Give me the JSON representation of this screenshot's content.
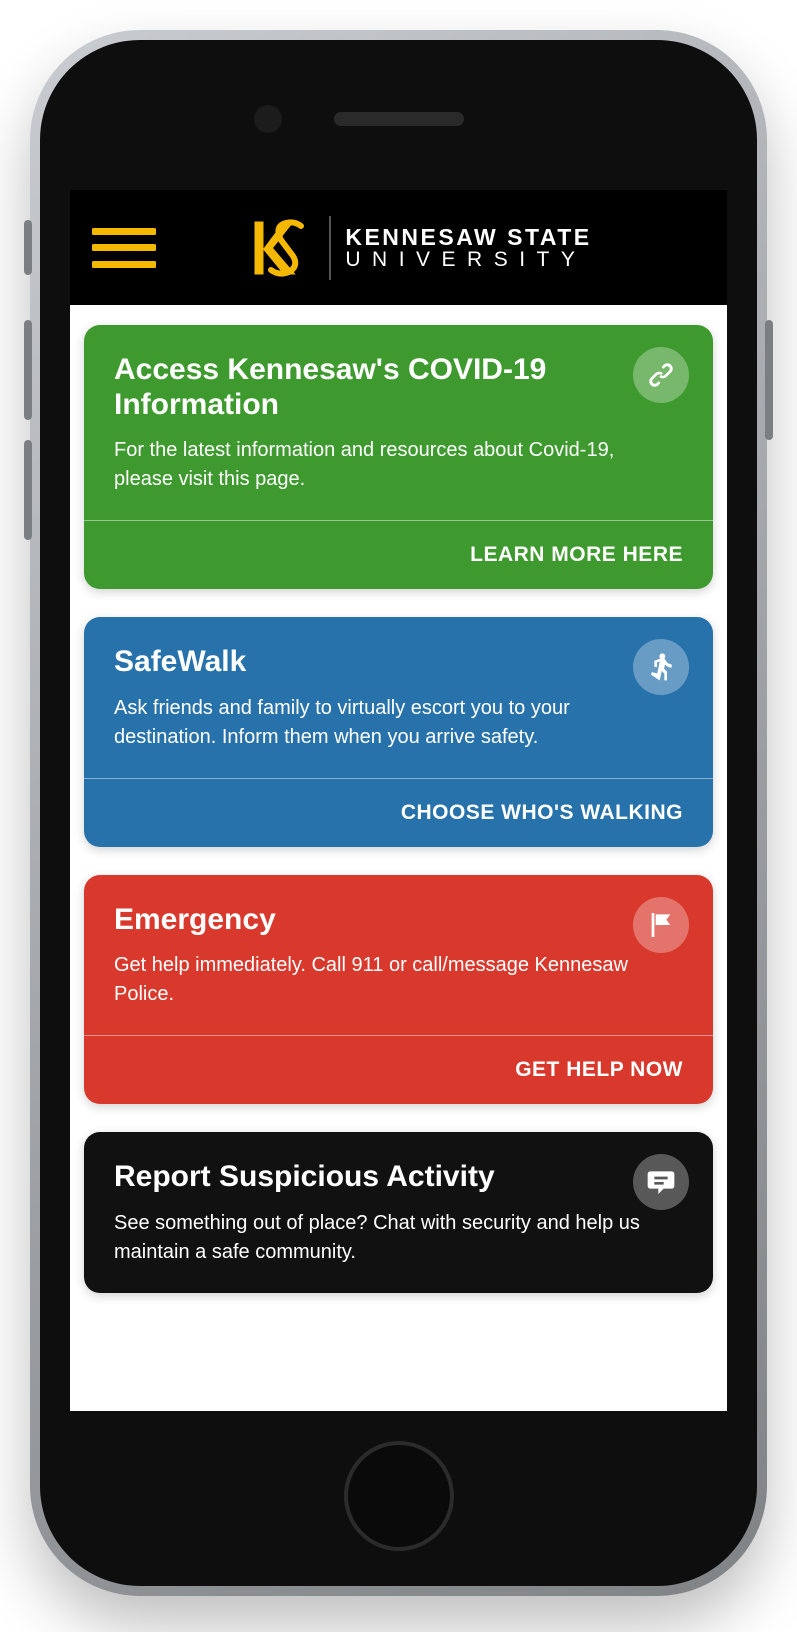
{
  "header": {
    "brand_line1": "KENNESAW STATE",
    "brand_line2": "UNIVERSITY"
  },
  "cards": [
    {
      "id": "covid",
      "title": "Access Kennesaw's COVID-19 Information",
      "desc": "For the latest information and resources about Covid-19, please visit this page.",
      "cta": "LEARN MORE HERE",
      "color": "#3e9a2e",
      "icon": "link"
    },
    {
      "id": "safewalk",
      "title": "SafeWalk",
      "desc": "Ask friends and family to virtually escort you to your destination. Inform them when you arrive safety.",
      "cta": "CHOOSE WHO'S WALKING",
      "color": "#2872ac",
      "icon": "walk"
    },
    {
      "id": "emergency",
      "title": "Emergency",
      "desc": "Get help immediately. Call 911 or call/message Kennesaw Police.",
      "cta": "GET HELP NOW",
      "color": "#d9392c",
      "icon": "flag"
    },
    {
      "id": "report",
      "title": "Report Suspicious Activity",
      "desc": "See something out of place? Chat with security and help us maintain a safe community.",
      "cta": "",
      "color": "#111111",
      "icon": "chat"
    }
  ]
}
